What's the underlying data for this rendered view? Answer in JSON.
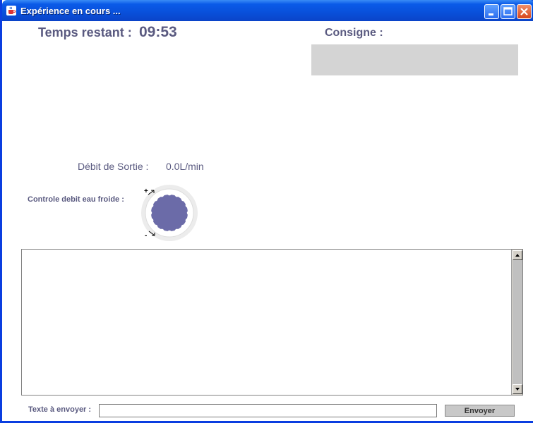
{
  "window": {
    "title": "Expérience en cours ...",
    "icon": "java-cup-icon",
    "controls": [
      "minimize-icon",
      "maximize-icon",
      "close-icon"
    ]
  },
  "timer": {
    "label": "Temps restant :",
    "value": "09:53"
  },
  "consigne": {
    "label": "Consigne :",
    "value": ""
  },
  "debit": {
    "label": "Débit de Sortie :",
    "value": "0.0L/min"
  },
  "control": {
    "label": "Controle debit eau froide :",
    "plus": "+",
    "minus": "-"
  },
  "message_area": {
    "value": ""
  },
  "send": {
    "label": "Texte à envoyer :",
    "input_value": "",
    "button_label": "Envoyer"
  },
  "colors": {
    "titlebar": "#0a50da",
    "knob": "#6b6ba8",
    "label_text": "#5a5a80",
    "consigne_box": "#d4d4d4"
  }
}
